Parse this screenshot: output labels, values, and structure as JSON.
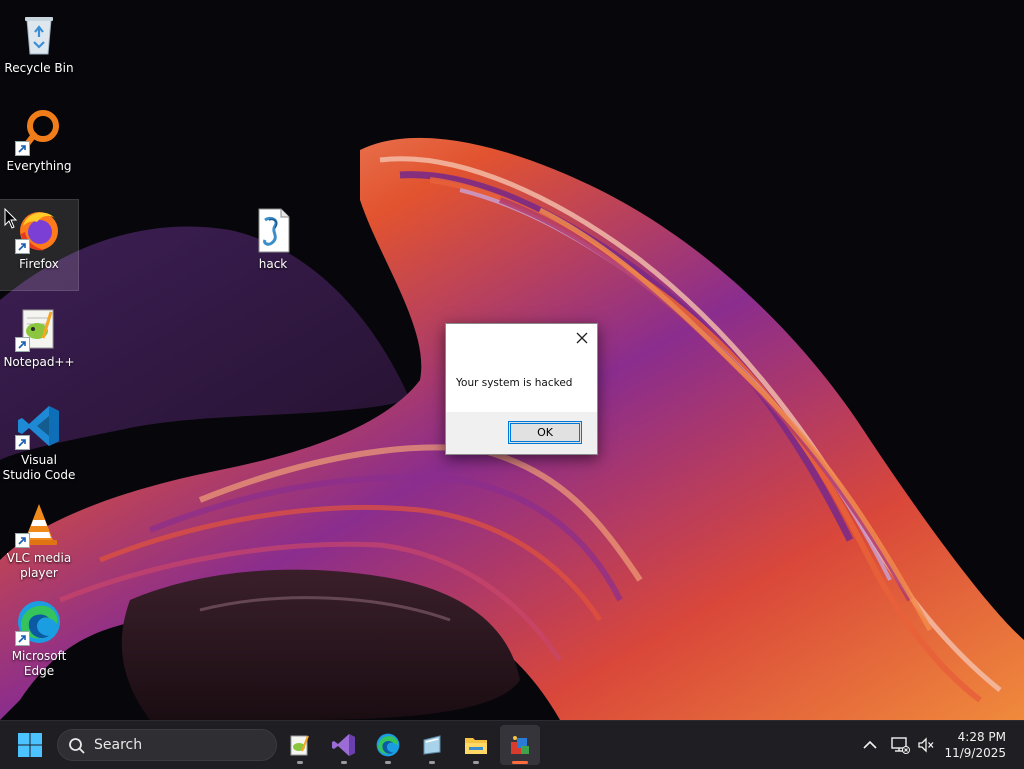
{
  "desktop": {
    "icons": [
      {
        "label": "Recycle Bin",
        "icon": "recycle-bin-icon"
      },
      {
        "label": "Everything",
        "icon": "everything-search-icon"
      },
      {
        "label": "Firefox",
        "icon": "firefox-icon"
      },
      {
        "label": "Notepad++",
        "icon": "notepadpp-icon"
      },
      {
        "label": "Visual Studio Code",
        "icon": "vscode-icon"
      },
      {
        "label": "VLC media player",
        "icon": "vlc-icon"
      },
      {
        "label": "Microsoft Edge",
        "icon": "edge-icon"
      },
      {
        "label": "hack",
        "icon": "script-file-icon"
      }
    ]
  },
  "dialog": {
    "title": "",
    "message": "Your system is hacked",
    "ok_label": "OK"
  },
  "taskbar": {
    "search_placeholder": "Search",
    "apps": [
      {
        "name": "notepadpp",
        "icon": "notepadpp-icon"
      },
      {
        "name": "visual-studio",
        "icon": "visual-studio-icon"
      },
      {
        "name": "edge",
        "icon": "edge-icon"
      },
      {
        "name": "app-4",
        "icon": "glass-app-icon"
      },
      {
        "name": "file-explorer",
        "icon": "folder-icon"
      },
      {
        "name": "app-6",
        "icon": "script-host-icon"
      }
    ],
    "clock": {
      "time": "4:28 PM",
      "date": "11/9/2025"
    }
  },
  "colors": {
    "taskbar_bg": "#1f1e22",
    "accent": "#0078d7",
    "active_indicator": "#ff6a3d"
  }
}
